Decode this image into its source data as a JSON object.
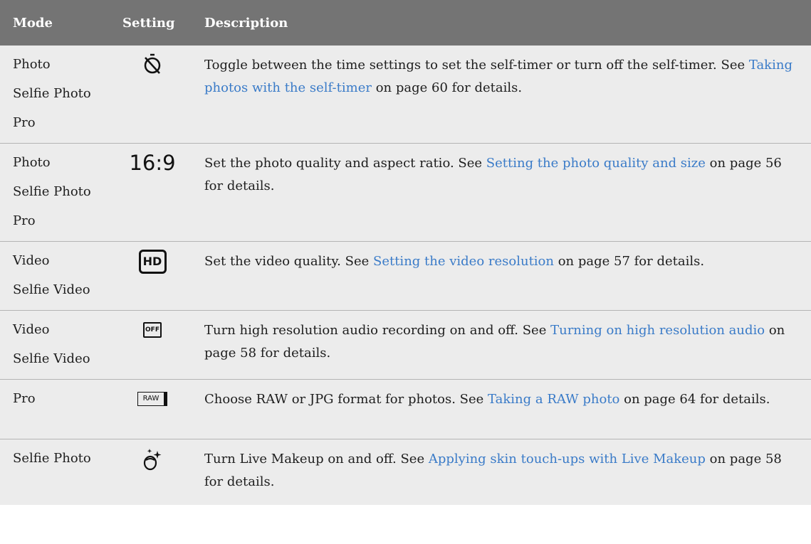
{
  "header": {
    "mode": "Mode",
    "setting": "Setting",
    "description": "Description"
  },
  "rows": [
    {
      "modes": [
        "Photo",
        "Selfie Photo",
        "Pro"
      ],
      "icon": "self-timer-off-icon",
      "desc_pre": "Toggle between the time settings to set the self-timer or turn off the self-timer. See ",
      "link": "Taking photos with the self-timer",
      "desc_post": " on page 60 for details."
    },
    {
      "modes": [
        "Photo",
        "Selfie Photo",
        "Pro"
      ],
      "icon_text": "16:9",
      "desc_pre": "Set the photo quality and aspect ratio. See ",
      "link": "Setting the photo quality and size",
      "desc_post": " on page 56 for details."
    },
    {
      "modes": [
        "Video",
        "Selfie Video"
      ],
      "icon_text": "HD",
      "desc_pre": "Set the video quality. See ",
      "link": "Setting the video resolution",
      "desc_post": " on page 57 for details."
    },
    {
      "modes": [
        "Video",
        "Selfie Video"
      ],
      "icon_text": "OFF",
      "desc_pre": "Turn high resolution audio recording on and off. See ",
      "link": "Turning on high resolution audio",
      "desc_post": " on page 58 for details."
    },
    {
      "modes": [
        "Pro"
      ],
      "icon_text": "RAW",
      "desc_pre": "Choose RAW or JPG format for photos. See ",
      "link": "Taking a RAW photo",
      "desc_post": " on page 64 for details."
    },
    {
      "modes": [
        "Selfie Photo"
      ],
      "icon": "live-makeup-icon",
      "desc_pre": "Turn Live Makeup on and off. See ",
      "link": "Applying skin touch-ups with Live Makeup",
      "desc_post": " on page 58 for details."
    }
  ]
}
